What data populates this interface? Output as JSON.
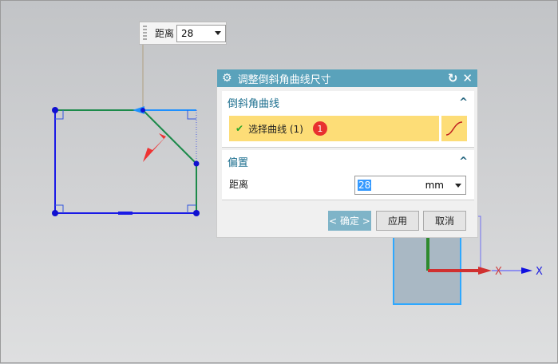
{
  "popup": {
    "label": "距离",
    "value": "28"
  },
  "dialog": {
    "title": "调整倒斜角曲线尺寸",
    "section1": {
      "header": "倒斜角曲线",
      "select_label": "选择曲线 (1)",
      "badge": "1"
    },
    "section2": {
      "header": "偏置",
      "distance_label": "距离",
      "distance_value": "28",
      "unit": "mm"
    },
    "buttons": {
      "ok": "< 确定 >",
      "apply": "应用",
      "cancel": "取消"
    }
  },
  "axes": {
    "x_label1": "X",
    "x_label2": "X"
  }
}
